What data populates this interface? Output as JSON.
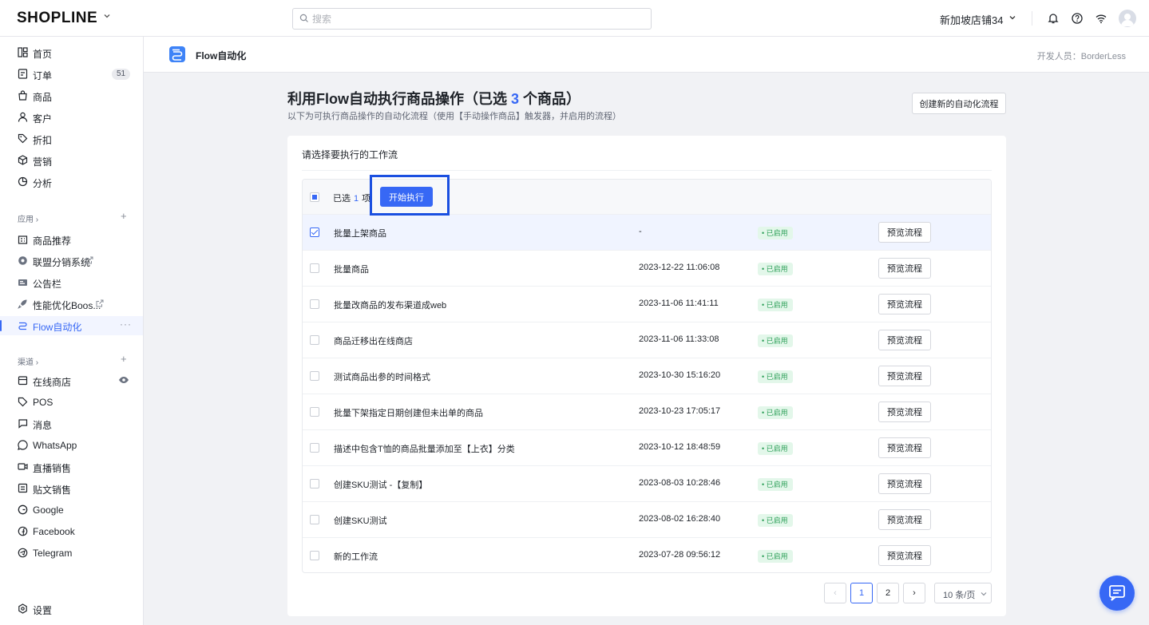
{
  "topbar": {
    "logo": "SHOPLINE",
    "search_placeholder": "搜索",
    "store_name": "新加坡店铺34"
  },
  "sidebar": {
    "main_items": [
      {
        "label": "首页",
        "icon": "grid-icon"
      },
      {
        "label": "订单",
        "icon": "order-icon",
        "badge": "51"
      },
      {
        "label": "商品",
        "icon": "bag-icon"
      },
      {
        "label": "客户",
        "icon": "person-icon"
      },
      {
        "label": "折扣",
        "icon": "tag-icon"
      },
      {
        "label": "营销",
        "icon": "cube-icon"
      },
      {
        "label": "分析",
        "icon": "chart-icon"
      }
    ],
    "apps_title": "应用",
    "apps": [
      {
        "label": "商品推荐",
        "icon": "building-icon"
      },
      {
        "label": "联盟分销系统",
        "icon": "network-icon",
        "external": true
      },
      {
        "label": "公告栏",
        "icon": "board-icon"
      },
      {
        "label": "性能优化Boos...",
        "icon": "rocket-icon",
        "external": true
      },
      {
        "label": "Flow自动化",
        "icon": "flow-icon",
        "active": true
      }
    ],
    "channels_title": "渠道",
    "channels": [
      {
        "label": "在线商店",
        "icon": "store-icon"
      },
      {
        "label": "POS",
        "icon": "pos-icon"
      },
      {
        "label": "消息",
        "icon": "message-icon"
      },
      {
        "label": "WhatsApp",
        "icon": "whatsapp-icon"
      },
      {
        "label": "直播销售",
        "icon": "live-icon"
      },
      {
        "label": "贴文销售",
        "icon": "post-icon"
      },
      {
        "label": "Google",
        "icon": "google-icon"
      },
      {
        "label": "Facebook",
        "icon": "facebook-icon"
      },
      {
        "label": "Telegram",
        "icon": "telegram-icon"
      }
    ],
    "settings_label": "设置"
  },
  "pagebar": {
    "title": "Flow自动化",
    "developer": "开发人员：BorderLess"
  },
  "main": {
    "heading_prefix": "利用Flow自动执行商品操作（已选",
    "heading_count": "3",
    "heading_suffix": "个商品）",
    "subtitle": "以下为可执行商品操作的自动化流程（使用【手动操作商品】触发器，并启用的流程）",
    "create_button": "创建新的自动化流程",
    "card_title": "请选择要执行的工作流",
    "selected_prefix": "已选",
    "selected_count": "1",
    "selected_suffix": "项",
    "run_button": "开始执行",
    "preview_label": "预览流程",
    "rows": [
      {
        "name": "批量上架商品",
        "date": "-",
        "status": "• 已启用",
        "checked": true
      },
      {
        "name": "批量商品",
        "date": "2023-12-22 11:06:08",
        "status": "• 已启用"
      },
      {
        "name": "批量改商品的发布渠道成web",
        "date": "2023-11-06 11:41:11",
        "status": "• 已启用"
      },
      {
        "name": "商品迁移出在线商店",
        "date": "2023-11-06 11:33:08",
        "status": "• 已启用"
      },
      {
        "name": "测试商品出参的时间格式",
        "date": "2023-10-30 15:16:20",
        "status": "• 已启用"
      },
      {
        "name": "批量下架指定日期创建但未出单的商品",
        "date": "2023-10-23 17:05:17",
        "status": "• 已启用"
      },
      {
        "name": "描述中包含T恤的商品批量添加至【上衣】分类",
        "date": "2023-10-12 18:48:59",
        "status": "• 已启用"
      },
      {
        "name": "创建SKU测试 -【复制】",
        "date": "2023-08-03 10:28:46",
        "status": "• 已启用"
      },
      {
        "name": "创建SKU测试",
        "date": "2023-08-02 16:28:40",
        "status": "• 已启用"
      },
      {
        "name": "新的工作流",
        "date": "2023-07-28 09:56:12",
        "status": "• 已启用"
      }
    ],
    "pagination": {
      "prev": "‹",
      "pages": [
        "1",
        "2"
      ],
      "current": "1",
      "next": "›",
      "page_size": "10 条/页"
    }
  },
  "colors": {
    "accent": "#3768f5",
    "status_green": "#2fa05a",
    "status_green_bg": "#e3f7ea"
  }
}
